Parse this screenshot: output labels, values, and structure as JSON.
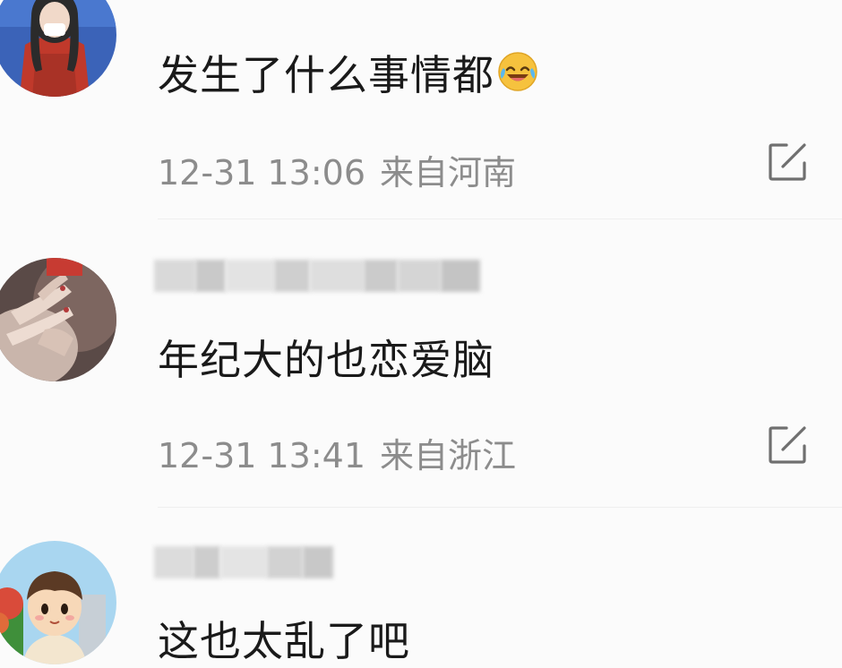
{
  "comments": [
    {
      "text": "发生了什么事情都",
      "emoji": "laugh-cry-emoji",
      "time": "12-31 13:06",
      "location": "来自河南",
      "share_icon": "share-icon"
    },
    {
      "text": "年纪大的也恋爱脑",
      "time": "12-31 13:41",
      "location": "来自浙江",
      "share_icon": "share-icon"
    },
    {
      "text": "这也太乱了吧"
    }
  ],
  "colors": {
    "text": "#1a1a1a",
    "meta": "#8c8c8c",
    "background": "#fbfbfb"
  }
}
